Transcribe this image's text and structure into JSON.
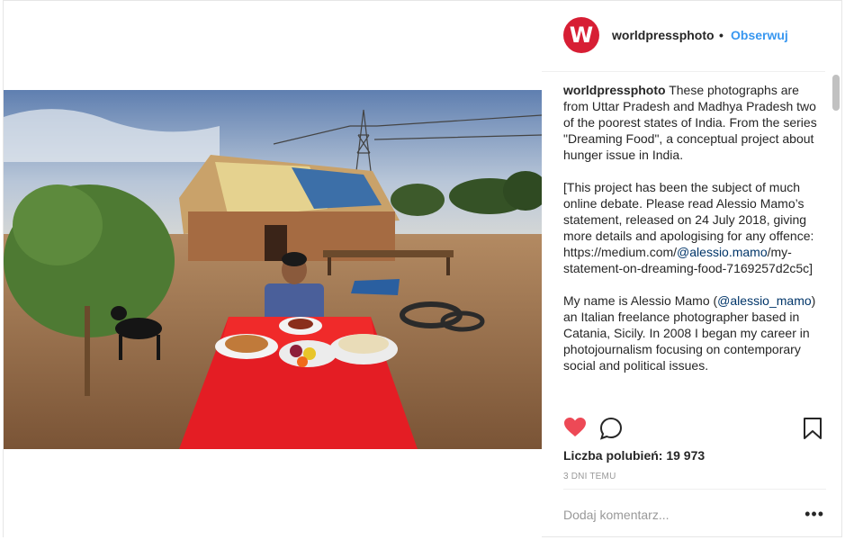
{
  "post": {
    "username": "worldpressphoto",
    "avatar_letter": "W",
    "separator": "•",
    "follow_label": "Obserwuj",
    "caption_text": " These photographs are from Uttar Pradesh and Madhya Pradesh two of the poorest states of India. From the series \"Dreaming Food\", a conceptual project about hunger issue in India.\n\n[This project has been the subject of much online debate. Please read Alessio Mamo’s statement, released on 24 July 2018, giving more details and apologising for any offence: \nhttps://medium.com/",
    "caption_mention_1": "@alessio.mamo",
    "caption_text_2": "/my-statement-on-dreaming-food-7169257d2c5c]\n\nMy name is Alessio Mamo (",
    "caption_mention_2": "@alessio_mamo",
    "caption_text_3": ") an Italian freelance photographer based in Catania, Sicily. In 2008 I began my career in photojournalism focusing on contemporary social and political issues.",
    "likes_label": "Liczba polubień: 19 973",
    "time_label": "3 DNI TEMU",
    "comment_placeholder": "Dodaj komentarz...",
    "more_label": "•••"
  },
  "colors": {
    "brand": "#d71e34",
    "link": "#3897f0",
    "like_red": "#ed4956"
  },
  "icons": [
    "heart-icon",
    "comment-icon",
    "bookmark-icon",
    "more-icon"
  ]
}
